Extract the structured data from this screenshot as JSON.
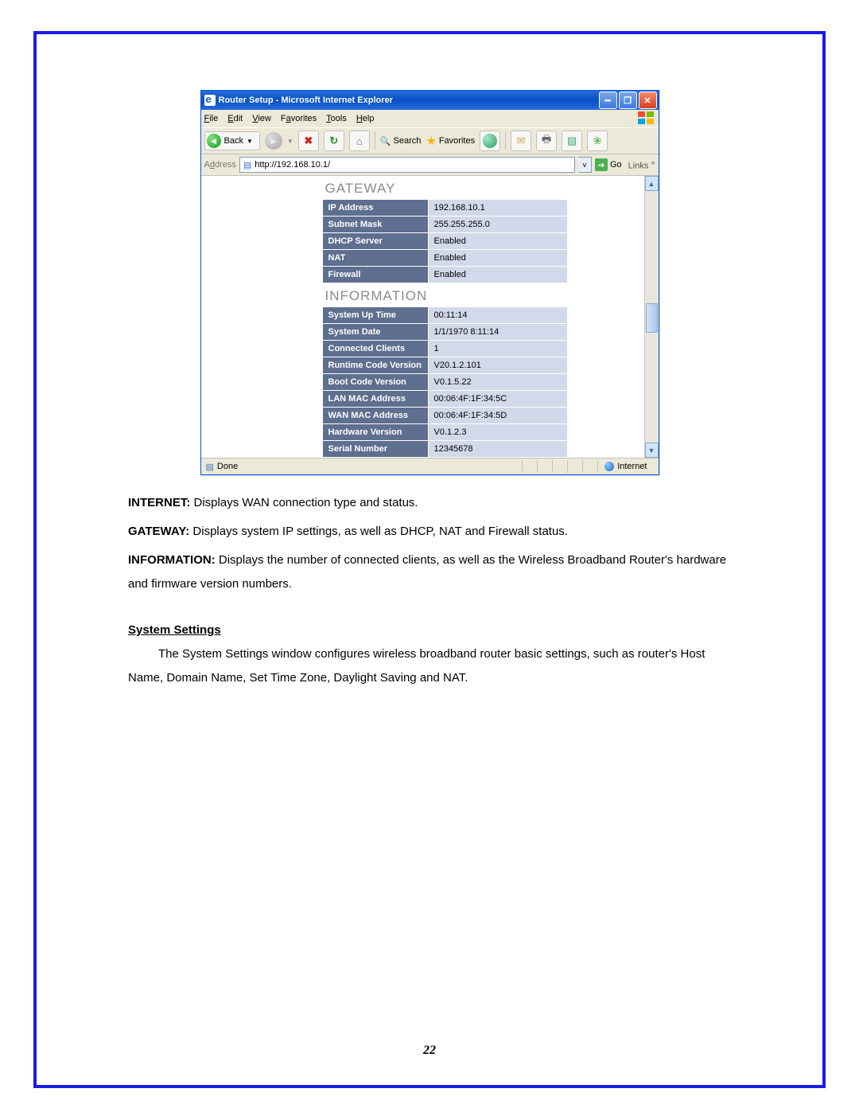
{
  "window": {
    "title": "Router Setup - Microsoft Internet Explorer",
    "menus": [
      "File",
      "Edit",
      "View",
      "Favorites",
      "Tools",
      "Help"
    ],
    "back_label": "Back",
    "search_label": "Search",
    "favorites_label": "Favorites",
    "address_label": "Address",
    "url": "http://192.168.10.1/",
    "go_label": "Go",
    "links_label": "Links",
    "status_left": "Done",
    "status_zone": "Internet"
  },
  "sections": {
    "gateway_header": "GATEWAY",
    "information_header": "INFORMATION"
  },
  "gateway": [
    {
      "k": "IP Address",
      "v": "192.168.10.1"
    },
    {
      "k": "Subnet Mask",
      "v": "255.255.255.0"
    },
    {
      "k": "DHCP Server",
      "v": "Enabled"
    },
    {
      "k": "NAT",
      "v": "Enabled"
    },
    {
      "k": "Firewall",
      "v": "Enabled"
    }
  ],
  "information": [
    {
      "k": "System Up Time",
      "v": "00:11:14"
    },
    {
      "k": "System Date",
      "v": "1/1/1970 8:11:14"
    },
    {
      "k": "Connected Clients",
      "v": "1"
    },
    {
      "k": "Runtime Code Version",
      "v": "V20.1.2.101"
    },
    {
      "k": "Boot Code Version",
      "v": "V0.1.5.22"
    },
    {
      "k": "LAN MAC Address",
      "v": "00:06:4F:1F:34:5C"
    },
    {
      "k": "WAN MAC Address",
      "v": "00:06:4F:1F:34:5D"
    },
    {
      "k": "Hardware Version",
      "v": "V0.1.2.3"
    },
    {
      "k": "Serial Number",
      "v": "12345678"
    }
  ],
  "doc": {
    "p1_b": "INTERNET:",
    "p1": " Displays WAN connection type and status.",
    "p2_b": "GATEWAY:",
    "p2": " Displays system IP settings, as well as DHCP, NAT and Firewall status.",
    "p3_b": "INFORMATION:",
    "p3": " Displays the number of connected clients, as well as the Wireless Broadband Router's hardware and firmware version numbers.",
    "sect": "System Settings",
    "p4": "The System Settings window configures wireless broadband router basic settings, such as router's Host Name, Domain Name, Set Time Zone, Daylight Saving and NAT.",
    "page_number": "22"
  }
}
